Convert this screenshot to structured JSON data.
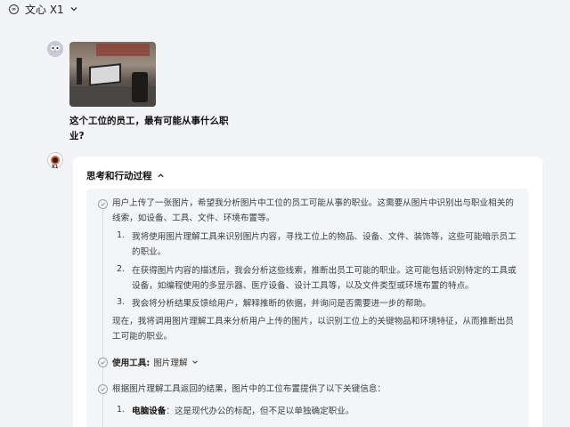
{
  "header": {
    "model_name": "文心 X1",
    "logo_glyph": "∞"
  },
  "user_message": {
    "text": "这个工位的员工，最有可能从事什么职业?"
  },
  "response": {
    "bot_badge": "X1",
    "thinking_title": "思考和行动过程",
    "intro": "用户上传了一张图片，希望我分析图片中工位的员工可能从事的职业。这需要从图片中识别出与职业相关的线索，如设备、工具、文件、环境布置等。",
    "steps": [
      {
        "num": "1.",
        "text": "我将使用图片理解工具来识别图片内容，寻找工位上的物品、设备、文件、装饰等，这些可能暗示员工的职业。"
      },
      {
        "num": "2.",
        "text": "在获得图片内容的描述后，我会分析这些线索，推断出员工可能的职业。这可能包括识别特定的工具或设备，如编程使用的多显示器、医疗设备、设计工具等，以及文件类型或环境布置的特点。"
      },
      {
        "num": "3.",
        "text": "我会将分析结果反馈给用户，解释推断的依据，并询问是否需要进一步的帮助。"
      }
    ],
    "conclusion": "现在，我将调用图片理解工具来分析用户上传的图片，以识别工位上的关键物品和环境特征，从而推断出员工可能的职业。",
    "tool_label": "使用工具:",
    "tool_name": "图片理解",
    "result_intro": "根据图片理解工具返回的结果，图片中的工位布置提供了以下关键信息：",
    "result_items": [
      {
        "num": "1.",
        "key": "电脑设备",
        "text": "：这是现代办公的标配，但不足以单独确定职业。"
      }
    ]
  }
}
